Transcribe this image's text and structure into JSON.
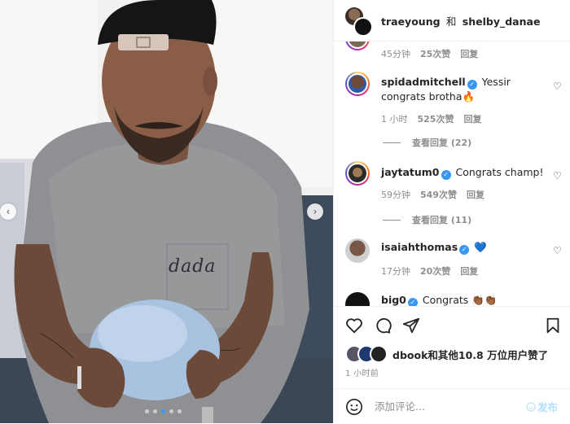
{
  "header": {
    "user1": "traeyoung",
    "separator": "和",
    "user2": "shelby_danae"
  },
  "photo": {
    "shirt_text": "dada",
    "carousel_dots": 5,
    "active_dot": 3
  },
  "comments": [
    {
      "username": "",
      "verified": false,
      "text": "",
      "time": "45分钟",
      "likes": "25次赞",
      "reply": "回复"
    },
    {
      "username": "spidadmitchell",
      "verified": true,
      "text": "Yessir congrats brotha🔥",
      "time": "1 小时",
      "likes": "525次赞",
      "reply": "回复",
      "view_replies": "查看回复 (22)"
    },
    {
      "username": "jaytatum0",
      "verified": true,
      "text": "Congrats champ!",
      "time": "59分钟",
      "likes": "549次赞",
      "reply": "回复",
      "view_replies": "查看回复 (11)"
    },
    {
      "username": "isaiahthomas",
      "verified": true,
      "text": "💙",
      "time": "17分钟",
      "likes": "20次赞",
      "reply": "回复"
    },
    {
      "username": "big0",
      "verified": true,
      "text": "Congrats 👏🏾👏🏾",
      "time": "",
      "likes": "",
      "reply": ""
    }
  ],
  "likes_summary": "dbook和其他10.8 万位用户赞了",
  "post_time": "1 小时前",
  "add_comment": {
    "placeholder": "添加评论...",
    "post_label": "发布"
  },
  "colors": {
    "accent": "#3897f0",
    "muted": "#8e8e8e",
    "post_disabled": "#b2dffc"
  }
}
